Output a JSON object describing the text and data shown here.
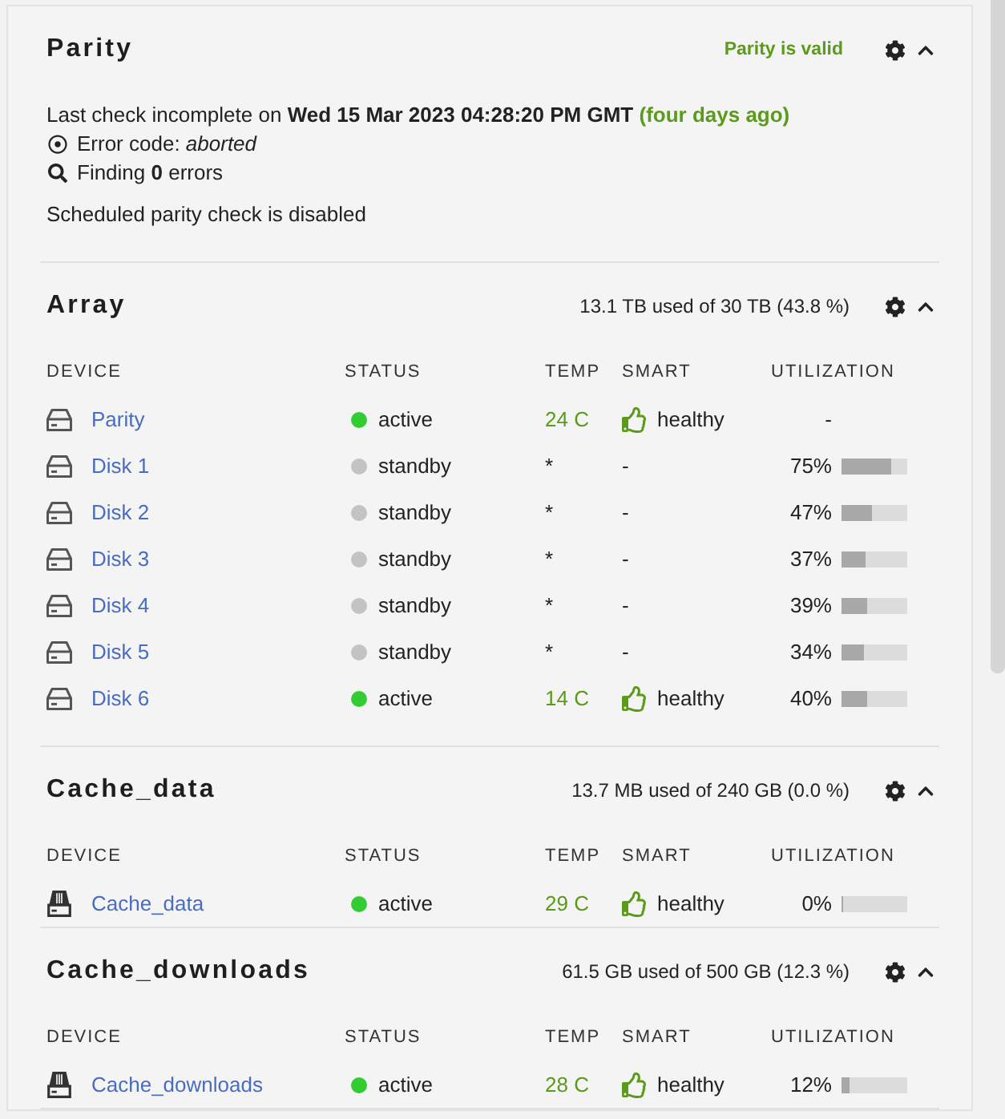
{
  "sections": [
    {
      "kind": "parity",
      "title": "Parity",
      "expanded": true,
      "status": "Parity is valid",
      "last_check": "Last check incomplete on **Wed 15 Mar 2023 04:28:20 PM GMT**",
      "last_check_ago": "(four days ago)",
      "error_code": "Error code: *aborted*",
      "finding": "Finding **0** errors",
      "schedule": "Scheduled parity check is disabled"
    },
    {
      "kind": "array",
      "title": "Array",
      "expanded": true,
      "usage": "13.1 TB used of 30 TB (43.8 %)",
      "columns": [
        "DEVICE",
        "STATUS",
        "TEMP",
        "SMART",
        "UTILIZATION"
      ],
      "rows": [
        {
          "kind": "hdd",
          "device": "Parity",
          "active": true,
          "status": "active",
          "temp": "24 C",
          "smart": "healthy",
          "healthy": true,
          "utilization": "-"
        },
        {
          "kind": "hdd",
          "device": "Disk 1",
          "active": false,
          "status": "standby",
          "temp": "*",
          "smart": "-",
          "healthy": false,
          "utilization": "75%",
          "level": 0.75
        },
        {
          "kind": "hdd",
          "device": "Disk 2",
          "active": false,
          "status": "standby",
          "temp": "*",
          "smart": "-",
          "healthy": false,
          "utilization": "47%",
          "level": 0.47
        },
        {
          "kind": "hdd",
          "device": "Disk 3",
          "active": false,
          "status": "standby",
          "temp": "*",
          "smart": "-",
          "healthy": false,
          "utilization": "37%",
          "level": 0.37
        },
        {
          "kind": "hdd",
          "device": "Disk 4",
          "active": false,
          "status": "standby",
          "temp": "*",
          "smart": "-",
          "healthy": false,
          "utilization": "39%",
          "level": 0.39
        },
        {
          "kind": "hdd",
          "device": "Disk 5",
          "active": false,
          "status": "standby",
          "temp": "*",
          "smart": "-",
          "healthy": false,
          "utilization": "34%",
          "level": 0.34
        },
        {
          "kind": "hdd",
          "device": "Disk 6",
          "active": true,
          "status": "active",
          "temp": "14 C",
          "smart": "healthy",
          "healthy": true,
          "utilization": "40%",
          "level": 0.4
        }
      ]
    },
    {
      "kind": "pool",
      "title": "Cache_data",
      "expanded": true,
      "usage": "13.7 MB used of 240 GB (0.0 %)",
      "columns": [
        "DEVICE",
        "STATUS",
        "TEMP",
        "SMART",
        "UTILIZATION"
      ],
      "rows": [
        {
          "kind": "ssd",
          "device": "Cache_data",
          "active": true,
          "status": "active",
          "temp": "29 C",
          "smart": "healthy",
          "healthy": true,
          "utilization": "0%",
          "level": 0
        }
      ]
    },
    {
      "kind": "pool",
      "title": "Cache_downloads",
      "expanded": true,
      "usage": "61.5 GB used of 500 GB (12.3 %)",
      "columns": [
        "DEVICE",
        "STATUS",
        "TEMP",
        "SMART",
        "UTILIZATION"
      ],
      "rows": [
        {
          "kind": "ssd",
          "device": "Cache_downloads",
          "active": true,
          "status": "active",
          "temp": "28 C",
          "smart": "healthy",
          "healthy": true,
          "utilization": "12%",
          "level": 0.12
        }
      ]
    }
  ]
}
